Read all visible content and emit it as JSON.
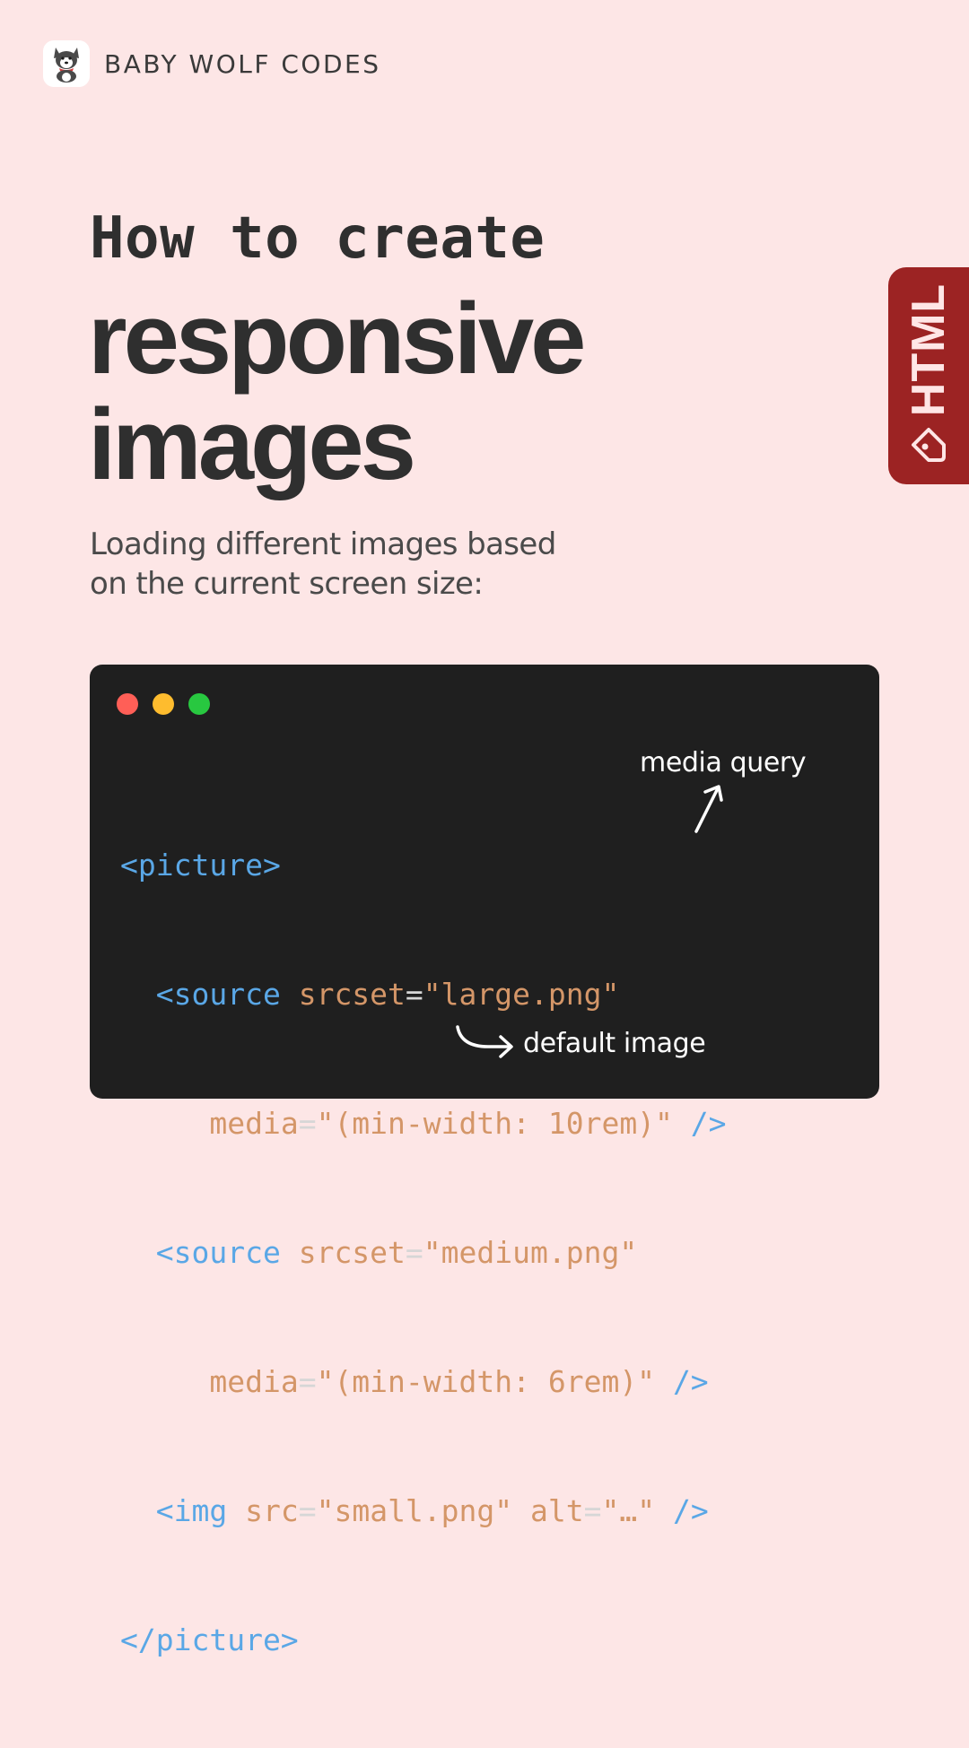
{
  "brand": {
    "name": "BABY WOLF CODES",
    "logo_icon": "wolf-mascot-icon"
  },
  "title": {
    "line1": "How to create",
    "line2": "responsive",
    "line3": "images"
  },
  "subtitle": {
    "line1": "Loading different images based",
    "line2": "on the current screen size:"
  },
  "tag": {
    "label": "HTML",
    "icon": "tag-icon",
    "color": "#9c2323"
  },
  "code_window": {
    "dots": [
      {
        "name": "close-dot",
        "color": "#ff5f57"
      },
      {
        "name": "minimize-dot",
        "color": "#febc2e"
      },
      {
        "name": "maximize-dot",
        "color": "#28c840"
      }
    ],
    "code": {
      "l1": {
        "open": "<picture>"
      },
      "l2": {
        "tag": "<source",
        "attr": "srcset",
        "eq": "=",
        "val": "\"large.png\""
      },
      "l3": {
        "attr": "media",
        "eq": "=",
        "val": "\"(min-width: 10rem)\"",
        "close": "/>"
      },
      "l4": {
        "tag": "<source",
        "attr": "srcset",
        "eq": "=",
        "val": "\"medium.png\""
      },
      "l5": {
        "attr": "media",
        "eq": "=",
        "val": "\"(min-width: 6rem)\"",
        "close": "/>"
      },
      "l6": {
        "tag": "<img",
        "attr1": "src",
        "eq1": "=",
        "val1": "\"small.png\"",
        "attr2": "alt",
        "eq2": "=",
        "val2": "\"…\"",
        "close": "/>"
      },
      "l7": {
        "close": "</picture>"
      }
    },
    "annotations": {
      "media_query": "media query",
      "default_image": "default image"
    }
  },
  "colors": {
    "background": "#fde6e6",
    "code_background": "#1f1f1f",
    "code_tag": "#5aa7e6",
    "code_attr": "#d49668",
    "text": "#2f2f2f"
  }
}
